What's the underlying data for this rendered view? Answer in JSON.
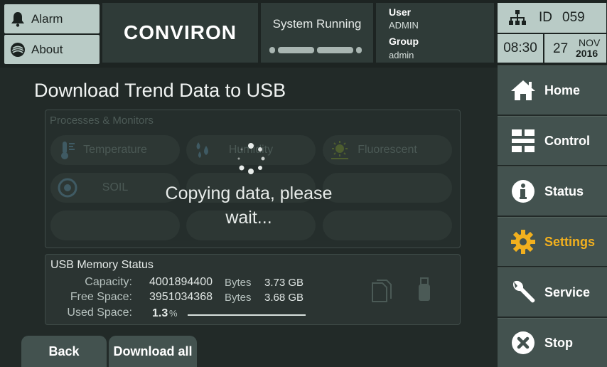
{
  "header": {
    "alarm_label": "Alarm",
    "about_label": "About",
    "brand": "CONVIRON",
    "system_status": "System Running",
    "user_label": "User",
    "user_value": "ADMIN",
    "group_label": "Group",
    "group_value": "admin",
    "id_label": "ID",
    "id_value": "059",
    "time": "08:30",
    "date_day": "27",
    "date_month": "NOV",
    "date_year": "2016"
  },
  "sidebar": {
    "items": [
      {
        "label": "Home",
        "icon": "home-icon"
      },
      {
        "label": "Control",
        "icon": "control-icon"
      },
      {
        "label": "Status",
        "icon": "info-icon"
      },
      {
        "label": "Settings",
        "icon": "gear-icon",
        "active": true
      },
      {
        "label": "Service",
        "icon": "wrench-icon"
      },
      {
        "label": "Stop",
        "icon": "stop-icon"
      }
    ]
  },
  "main": {
    "title": "Download Trend Data to USB",
    "processes_title": "Processes & Monitors",
    "processes": [
      {
        "label": "Temperature",
        "icon": "thermometer-icon"
      },
      {
        "label": "Humidity",
        "icon": "humidity-icon"
      },
      {
        "label": "Fluorescent",
        "icon": "light-icon"
      },
      {
        "label": "SOIL",
        "icon": "soil-icon"
      }
    ],
    "overlay_message": "Copying data, please wait...",
    "usb": {
      "title": "USB Memory Status",
      "capacity_label": "Capacity:",
      "capacity_bytes": "4001894400",
      "capacity_gb": "3.73",
      "free_label": "Free Space:",
      "free_bytes": "3951034368",
      "free_gb": "3.68",
      "used_label": "Used Space:",
      "used_value": "1.3",
      "used_unit": "%",
      "bytes_unit": "Bytes",
      "gb_unit": "GB"
    },
    "back_label": "Back",
    "download_all_label": "Download all"
  },
  "colors": {
    "accent": "#f2b01e",
    "panel": "#b9cbc6",
    "nav": "#43524f",
    "background": "#222a28"
  }
}
